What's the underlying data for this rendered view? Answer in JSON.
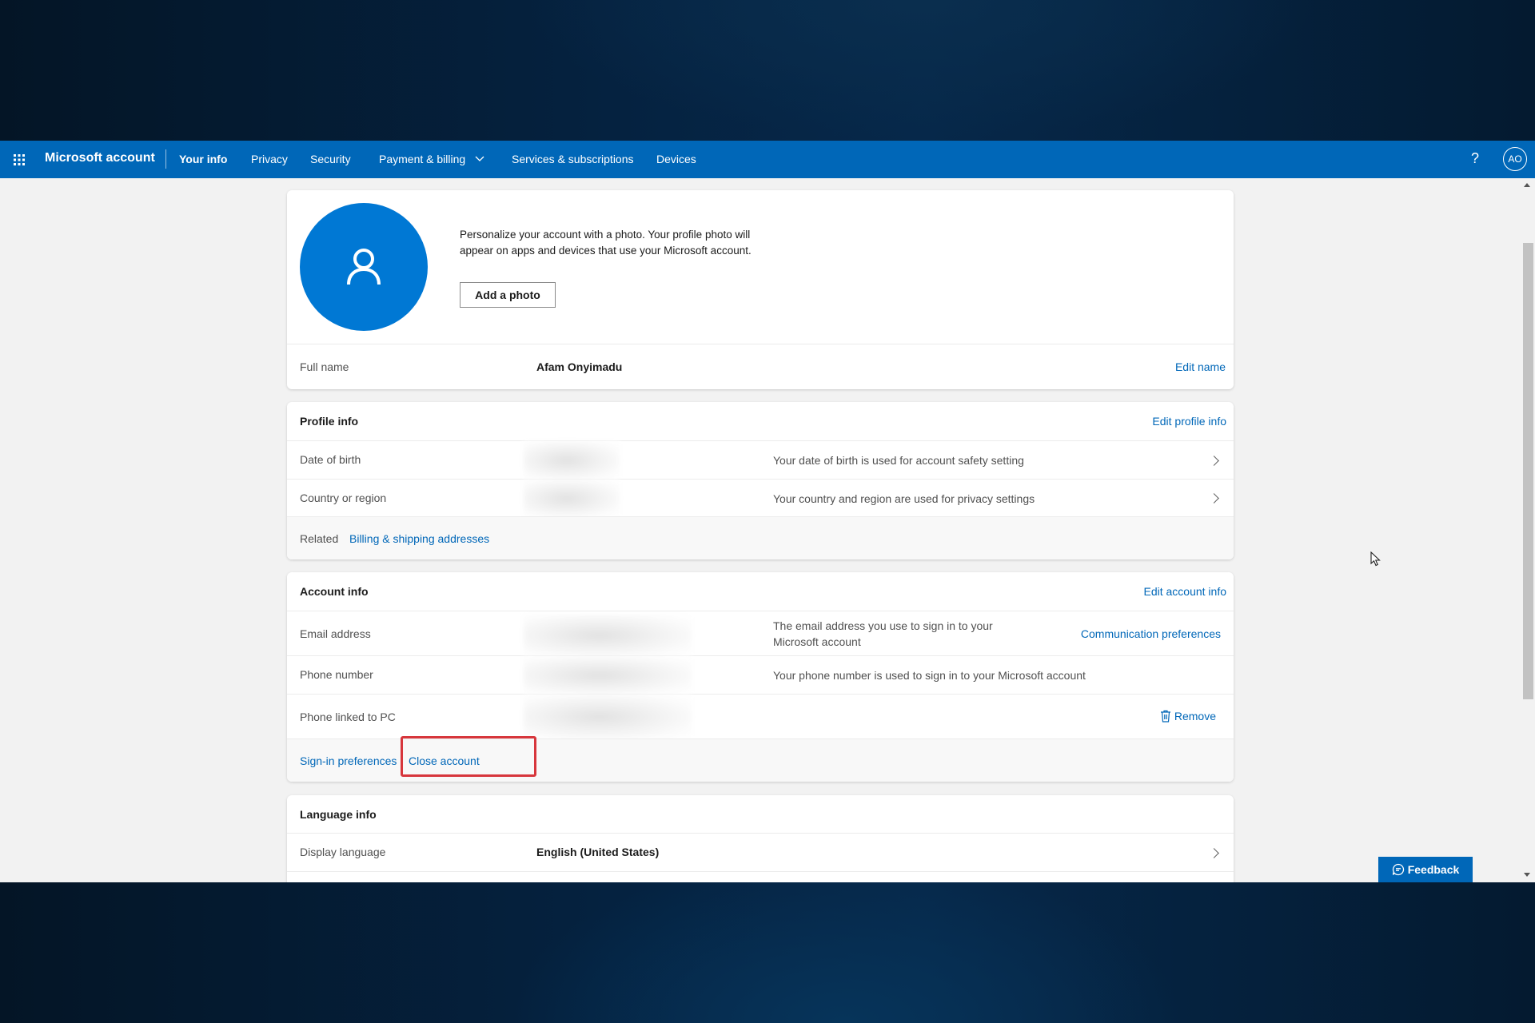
{
  "nav": {
    "brand": "Microsoft account",
    "items": [
      {
        "label": "Your info",
        "active": true
      },
      {
        "label": "Privacy"
      },
      {
        "label": "Security"
      },
      {
        "label": "Payment & billing",
        "has_dropdown": true
      },
      {
        "label": "Services & subscriptions"
      },
      {
        "label": "Devices"
      }
    ],
    "help_label": "?",
    "avatar_initials": "AO"
  },
  "profile_card": {
    "photo_text": "Personalize your account with a photo. Your profile photo will appear on apps and devices that use your Microsoft account.",
    "add_photo_label": "Add a photo",
    "full_name_label": "Full name",
    "full_name_value": "Afam Onyimadu",
    "edit_name_label": "Edit name"
  },
  "profile_info": {
    "title": "Profile info",
    "edit_label": "Edit profile info",
    "rows": [
      {
        "label": "Date of birth",
        "value_hidden": true,
        "description": "Your date of birth is used for account safety setting"
      },
      {
        "label": "Country or region",
        "value_hidden": true,
        "description": "Your country and region are used for privacy settings"
      }
    ],
    "related_label": "Related",
    "related_link": "Billing & shipping addresses"
  },
  "account_info": {
    "title": "Account info",
    "edit_label": "Edit account info",
    "rows": [
      {
        "label": "Email address",
        "value_hidden": true,
        "description": "The email address you use to sign in to your Microsoft account",
        "action": "Communication preferences"
      },
      {
        "label": "Phone number",
        "value_hidden": true,
        "description": "Your phone number is used to sign in to your Microsoft account"
      },
      {
        "label": "Phone linked to PC",
        "value_hidden": true,
        "action": "Remove"
      }
    ],
    "footer_links": [
      "Sign-in preferences",
      "Close account"
    ],
    "highlighted_link": "Close account"
  },
  "language_info": {
    "title": "Language info",
    "rows": [
      {
        "label": "Display language",
        "value": "English (United States)"
      }
    ]
  },
  "feedback_label": "Feedback",
  "colors": {
    "brand_blue": "#0067b8",
    "avatar_blue": "#0078d4",
    "highlight_red": "#d7363c"
  }
}
